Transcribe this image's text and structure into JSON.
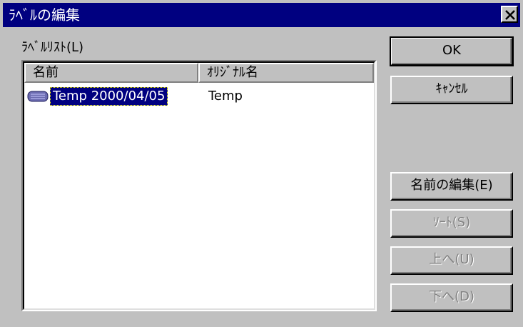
{
  "window": {
    "title": "ﾗﾍﾞﾙの編集"
  },
  "list": {
    "label": "ﾗﾍﾞﾙﾘｽﾄ(L)",
    "columns": [
      "名前",
      "ｵﾘｼﾞﾅﾙ名"
    ],
    "rows": [
      {
        "name": "Temp 2000/04/05",
        "original": "Temp",
        "icon": "tape-icon",
        "selected": true
      }
    ]
  },
  "buttons": {
    "ok": "OK",
    "cancel": "ｷｬﾝｾﾙ",
    "edit_name": "名前の編集(E)",
    "sort": "ｿｰﾄ(S)",
    "up": "上へ(U)",
    "down": "下へ(D)"
  },
  "colors": {
    "titlebar": "#000080",
    "face": "#c0c0c0",
    "selection": "#000080"
  }
}
